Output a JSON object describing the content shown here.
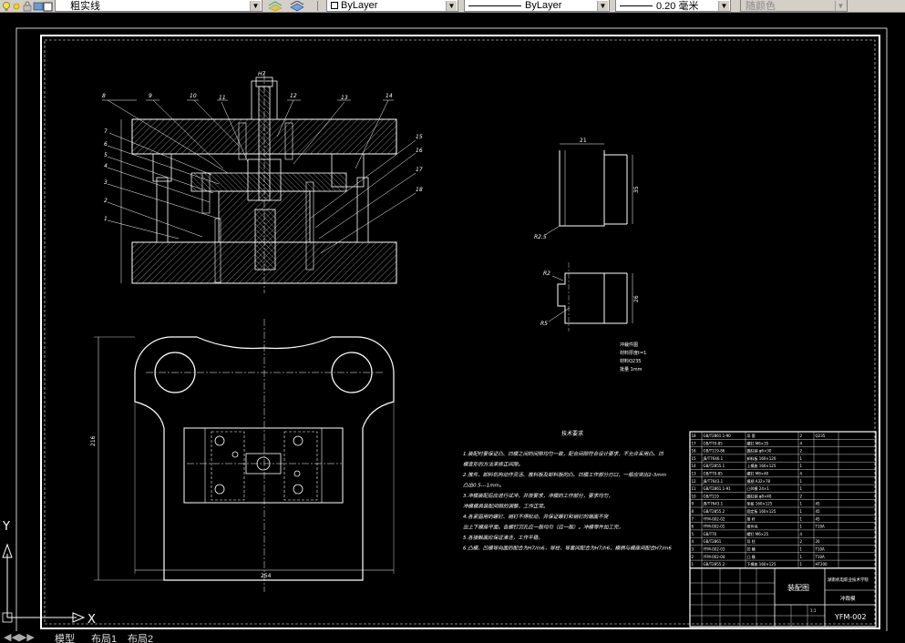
{
  "toolbar": {
    "linetype_label": "粗实线",
    "color_label": "ByLayer",
    "line_label": "ByLayer",
    "lineweight_label": "0.20 毫米",
    "plotstyle_label": "随颜色"
  },
  "drawing": {
    "part_labels": [
      "8",
      "9",
      "10",
      "11",
      "H7",
      "12",
      "13",
      "14",
      "7",
      "6",
      "5",
      "4",
      "3",
      "2",
      "1",
      "15",
      "16",
      "17",
      "18"
    ],
    "dim_top_width": "21",
    "dim_right_height": "35",
    "dim_r25": "R2.5",
    "dim_r2": "R2",
    "dim_r5": "R5",
    "dim_26": "26",
    "dim_216": "216",
    "dim_254": "254",
    "notes_small": [
      "冲裁件图",
      "材料厚度t=1",
      "材料Q235",
      "批量 1mm"
    ],
    "tech_title": "技术要求",
    "tech_lines": [
      "1.装配时要保证凸、凹模之间的间隙均匀一致，配合间隙符合设计要求，不允许采用凸、凹",
      "  模变形的方法来修正间隙。",
      "2.推件、卸料机构动作灵活、推料板及卸料板的凸、凹模工作部分刃口，一般应突出2-3mm",
      "  凸出0.5---1mm。",
      "3.冲模装配后应进行试冲，并按要求，冲模的工作部分，要求均匀，",
      "  冲模模具装配间隙的调整，工作正常。",
      "4.各紧固用的螺钉、销钉不得松动，并保证螺钉和销钉的端面不突",
      "  出上下模座平面。各螺钉沉孔应一般均匀（应一般）。冲模零件加工完，",
      "5.各接触面应保证清洁，工作平稳。",
      "6.凸模、凹模导向面的配合为H7/m6，导柱、导套间配合为H7/h6，模柄与模座间配合H7/m6"
    ],
    "bom_rows": [
      [
        "18",
        "GB/T2861.1-90",
        "导 套",
        "2",
        "Q235"
      ],
      [
        "17",
        "GB/T70-85",
        "螺钉 M6×35",
        "4",
        ""
      ],
      [
        "16",
        "GB/T119-86",
        "圆柱销 φ6×30",
        "2",
        ""
      ],
      [
        "15",
        "JB/T7646.1",
        "卸料板 160×120",
        "1",
        ""
      ],
      [
        "14",
        "GB/T2855.1",
        "上模座 160×125",
        "1",
        ""
      ],
      [
        "13",
        "GB/T70-85",
        "螺钉 M8×40",
        "4",
        ""
      ],
      [
        "12",
        "JB/T7643.1",
        "模柄 A32×78",
        "1",
        ""
      ],
      [
        "11",
        "GB/T2861.1-91",
        "凸凹模 24×1",
        "1",
        ""
      ],
      [
        "10",
        "GB/T119",
        "圆柱销 φ8×40",
        "2",
        ""
      ],
      [
        "9",
        "JB/T7643.1",
        "垫板 160×125",
        "1",
        "45"
      ],
      [
        "8",
        "GB/T2855.2",
        "固定板 160×125",
        "1",
        "45"
      ],
      [
        "7",
        "YFM-002-02",
        "推 杆",
        "1",
        "45"
      ],
      [
        "6",
        "YFM-002-01",
        "推件块",
        "1",
        "T10A"
      ],
      [
        "5",
        "GB/T70",
        "螺钉 M6×25",
        "4",
        ""
      ],
      [
        "4",
        "GB/T2861",
        "导 柱",
        "2",
        "20"
      ],
      [
        "3",
        "YFM-002-03",
        "凹 模",
        "1",
        "T10A"
      ],
      [
        "2",
        "YFM-002-04",
        "凸 模",
        "1",
        "T10A"
      ],
      [
        "1",
        "GB/T2855.2",
        "下模座 160×125",
        "1",
        "HT200"
      ]
    ],
    "title_block": {
      "drawing_name": "装配图",
      "school": "湖南机电职业技术学院",
      "product": "冲裁模",
      "code": "YFM-002",
      "scale": "1:1"
    }
  },
  "ucs": {
    "x_label": "X",
    "y_label": "Y"
  },
  "tabs": {
    "model": "模型",
    "layout1": "布局1",
    "layout2": "布局2"
  }
}
